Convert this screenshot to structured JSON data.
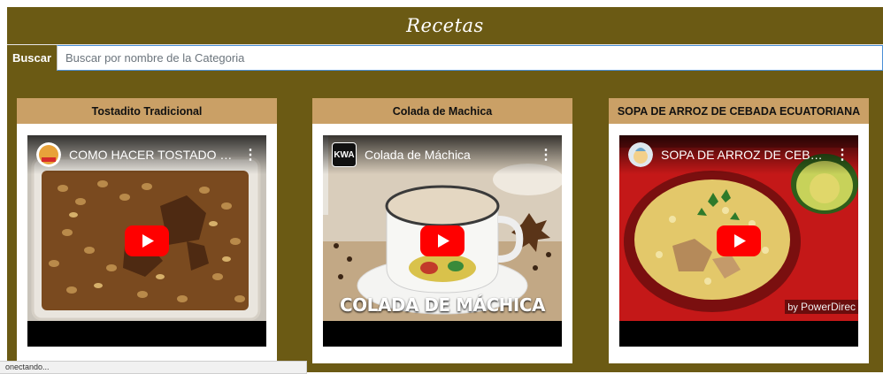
{
  "header": {
    "title": "Recetas"
  },
  "search": {
    "label": "Buscar",
    "placeholder": "Buscar por nombre de la Categoria",
    "value": ""
  },
  "cards": [
    {
      "title": "Tostadito Tradicional",
      "video_title": "COMO HACER TOSTADO S...",
      "channel_icon": "cooking-channel-avatar",
      "overlay": ""
    },
    {
      "title": "Colada de Machica",
      "video_title": "Colada de Máchica",
      "channel_icon": "KWA",
      "overlay": "COLADA DE MÁCHICA"
    },
    {
      "title": "SOPA DE ARROZ DE CEBADA ECUATORIANA",
      "video_title": "SOPA DE ARROZ DE CEBAD...",
      "channel_icon": "soup-channel-avatar",
      "watermark_by": "by",
      "watermark": "PowerDirec"
    }
  ],
  "status_text": "onectando...",
  "colors": {
    "brand": "#6b5a14",
    "card_header": "#caa066",
    "youtube_red": "#ff0000"
  },
  "icons": [
    "play-icon",
    "kebab-menu-icon",
    "channel-avatar-icon"
  ]
}
